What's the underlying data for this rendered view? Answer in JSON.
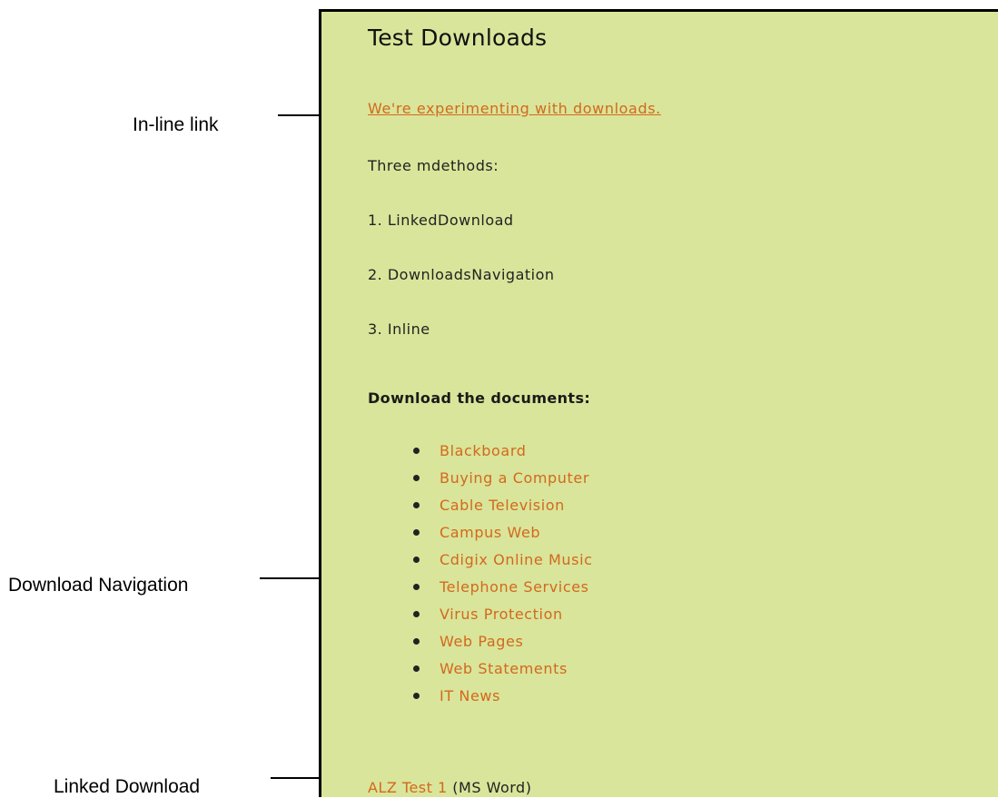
{
  "page": {
    "title": "Test Downloads",
    "intro_link": "We're experimenting with downloads.",
    "methods_intro": "Three mdethods:",
    "methods": [
      "1. LinkedDownload",
      "2. DownloadsNavigation",
      "3. Inline"
    ],
    "documents_heading": "Download the documents:",
    "documents": [
      "Blackboard",
      "Buying a Computer",
      "Cable Television",
      "Campus Web",
      "Cdigix Online Music",
      "Telephone Services",
      "Virus Protection",
      "Web Pages",
      "Web Statements",
      "IT News"
    ],
    "linked_download": {
      "label": "ALZ Test 1",
      "note": " (MS Word)"
    }
  },
  "annotations": {
    "inline": "In-line link",
    "navigation": "Download Navigation",
    "linked": "Linked Download"
  },
  "colors": {
    "panel_background": "#d9e59a",
    "link": "#d2691e",
    "text": "#222222"
  }
}
